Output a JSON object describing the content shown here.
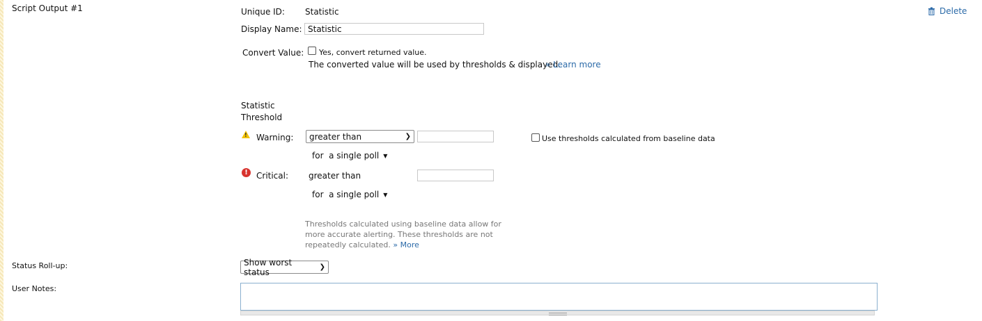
{
  "section": {
    "title": "Script Output #1",
    "delete_label": "Delete"
  },
  "unique_id": {
    "label": "Unique ID:",
    "value": "Statistic"
  },
  "display_name": {
    "label": "Display Name:",
    "value": "Statistic"
  },
  "convert_value": {
    "label": "Convert Value:",
    "checkbox_label": "Yes, convert returned value.",
    "note": "The converted value will be used by thresholds & displayed.",
    "learn_more": "» Learn more"
  },
  "threshold": {
    "heading_line1": "Statistic",
    "heading_line2": "Threshold",
    "warning": {
      "label": "Warning:",
      "operator": "greater than",
      "value": "",
      "poll": "for  a single poll"
    },
    "critical": {
      "label": "Critical:",
      "operator": "greater than",
      "value": "",
      "poll": "for  a single poll"
    },
    "baseline_checkbox_label": "Use thresholds calculated from baseline data",
    "help_text": "Thresholds calculated using baseline data allow for more accurate alerting. These thresholds are not repeatedly calculated.",
    "more_link": "» More"
  },
  "status_rollup": {
    "label": "Status Roll-up:",
    "value": "Show worst status"
  },
  "user_notes": {
    "label": "User Notes:",
    "value": ""
  },
  "icons": {
    "delete": "trash-icon",
    "warning": "warning-triangle-icon",
    "critical": "critical-exclamation-icon"
  }
}
